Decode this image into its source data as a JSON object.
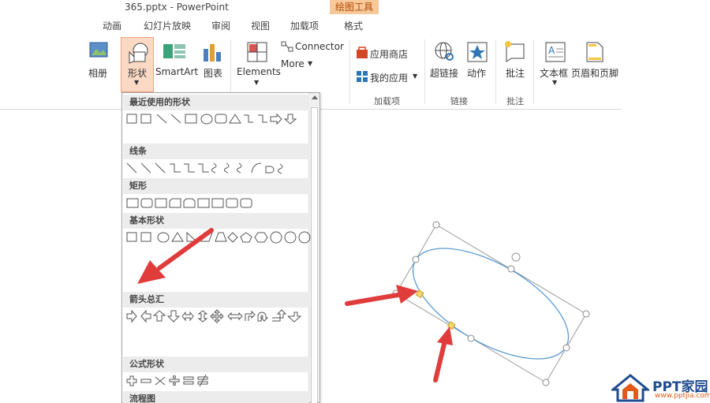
{
  "window": {
    "title": "365.pptx - PowerPoint",
    "contextual_tab": "绘图工具"
  },
  "tabs": [
    "动画",
    "幻灯片放映",
    "审阅",
    "视图",
    "加载项",
    "格式"
  ],
  "ribbon": {
    "album": "相册",
    "shapes": "形状",
    "smartart": "SmartArt",
    "chart": "图表",
    "elements": "Elements",
    "connector": "Connector",
    "more": "More",
    "app_store": "应用商店",
    "my_apps": "我的应用",
    "hyperlink": "超链接",
    "action": "动作",
    "comment": "批注",
    "textbox": "文本框",
    "header_footer": "页眉和页脚",
    "groups": {
      "addins": "加载项",
      "links": "链接",
      "comments": "批注"
    }
  },
  "dropdown": {
    "categories": [
      "最近使用的形状",
      "线条",
      "矩形",
      "基本形状",
      "箭头总汇",
      "公式形状",
      "流程图"
    ]
  },
  "watermark": {
    "brand": "PPT家园",
    "url": "www.pptjia.com"
  },
  "colors": {
    "accent": "#d24726",
    "arrow": "#e03c3c",
    "handle": "#f5d76e",
    "ellipse": "#4e8fcf"
  }
}
